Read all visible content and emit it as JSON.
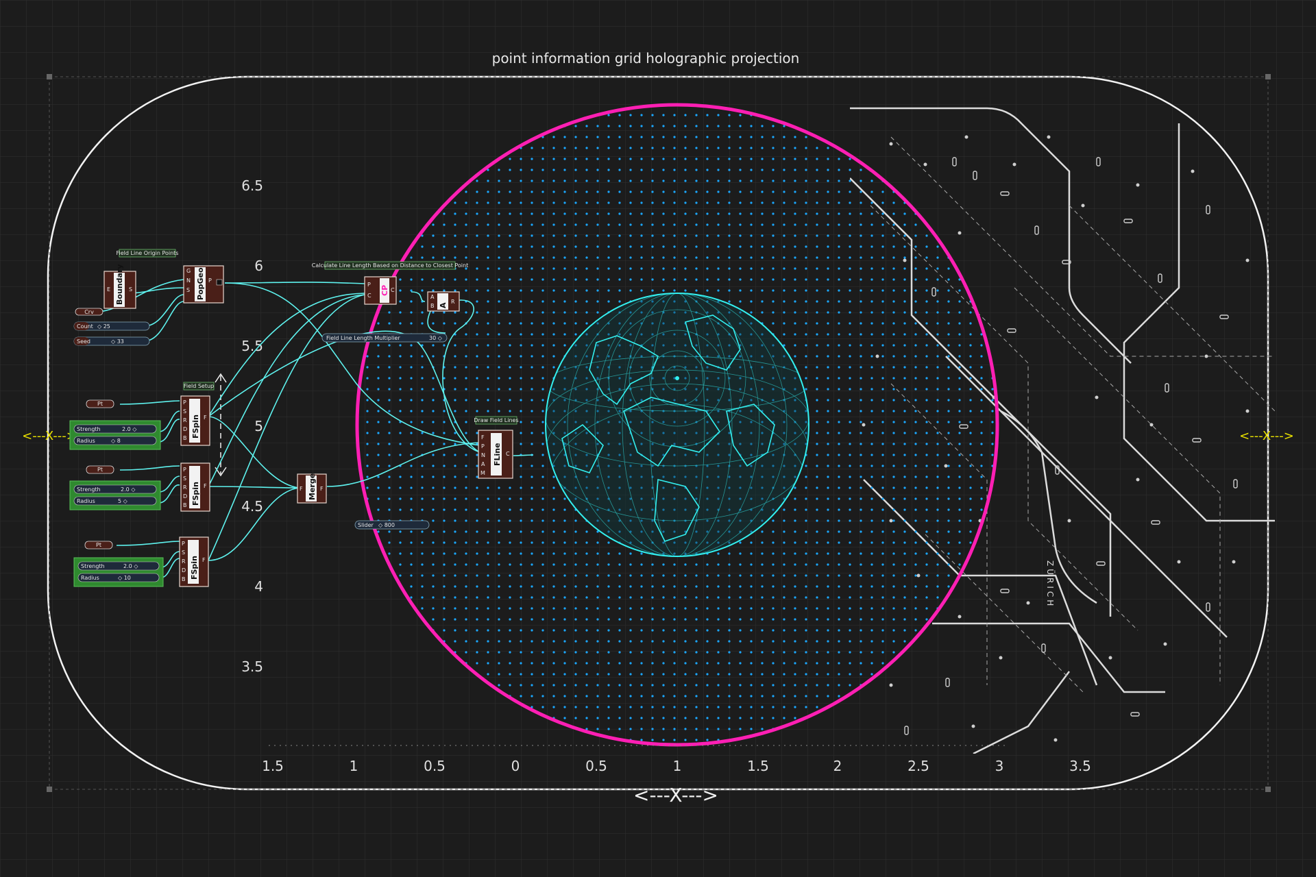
{
  "title": "point information grid holographic projection",
  "axis_markers": {
    "left": "<---X--->",
    "right": "<---X--->",
    "bottom": "<---X--->"
  },
  "y_ticks": [
    "6.5",
    "6",
    "5.5",
    "5",
    "4.5",
    "4",
    "3.5"
  ],
  "x_ticks": [
    "1.5",
    "1",
    "0.5",
    "0",
    "0.5",
    "1",
    "1.5",
    "2",
    "2.5",
    "3",
    "3.5"
  ],
  "map_label": "ZÜRICH",
  "colors": {
    "background": "#1c1c1c",
    "grid": "#333333",
    "frame": "#f2f2f2",
    "ring": "#ff1fb4",
    "dots": "#1aa8ff",
    "globe": "#33f0f0",
    "wire": "#5ef2ee",
    "node": "#4a1f18",
    "slider": "#2f8a2f",
    "axis_marker": "#e8e000"
  },
  "groups": {
    "field_line_origin": "Field Line Origin Points",
    "calc_line_length": "Calculate Line Length Based on Distance to Closest Point",
    "field_setup": "Field Setup",
    "draw_field_lines": "Draw Field Lines"
  },
  "nodes": {
    "boundary": {
      "name": "Boundary",
      "ports_in": [
        "E"
      ],
      "ports_out": [
        "S"
      ]
    },
    "popgeo": {
      "name": "PopGeo",
      "ports_in": [
        "G",
        "N",
        "S"
      ],
      "ports_out": [
        "P"
      ]
    },
    "cp": {
      "name": "CP",
      "ports_in": [
        "P",
        "C"
      ],
      "ports_out": [
        "C"
      ]
    },
    "area": {
      "name": "A",
      "ports_in": [
        "A",
        "B"
      ],
      "ports_out": [
        "R"
      ]
    },
    "fspin1": {
      "name": "FSpin",
      "ports_in": [
        "P",
        "S",
        "R",
        "D",
        "B"
      ],
      "ports_out": [
        "F"
      ]
    },
    "fspin2": {
      "name": "FSpin",
      "ports_in": [
        "P",
        "S",
        "R",
        "D",
        "B"
      ],
      "ports_out": [
        "F"
      ]
    },
    "fspin3": {
      "name": "FSpin",
      "ports_in": [
        "P",
        "S",
        "R",
        "D",
        "B"
      ],
      "ports_out": [
        "F"
      ]
    },
    "merge": {
      "name": "Merge",
      "ports_in": [
        "F"
      ],
      "ports_out": [
        "F"
      ]
    },
    "fline": {
      "name": "FLine",
      "ports_in": [
        "F",
        "P",
        "N",
        "A",
        "M"
      ],
      "ports_out": [
        "C"
      ]
    }
  },
  "params": {
    "crv": "Crv",
    "count": {
      "label": "Count",
      "value": "◇ 25"
    },
    "seed": {
      "label": "Seed",
      "value": "◇ 33"
    },
    "pt1": "Pt",
    "pt2": "Pt",
    "pt3": "Pt",
    "multiplier": {
      "label": "Field Line Length Multiplier",
      "value": "30 ◇"
    },
    "slider": {
      "label": "Slider",
      "value": "◇ 800"
    }
  },
  "sliders": [
    {
      "label1": "Strength",
      "value1": "2.0 ◇",
      "label2": "Radius",
      "value2": "◇ 8"
    },
    {
      "label1": "Strength",
      "value1": "2.0 ◇",
      "label2": "Radius",
      "value2": "5 ◇"
    },
    {
      "label1": "Strength",
      "value1": "2.0 ◇",
      "label2": "Radius",
      "value2": "◇ 10"
    }
  ]
}
